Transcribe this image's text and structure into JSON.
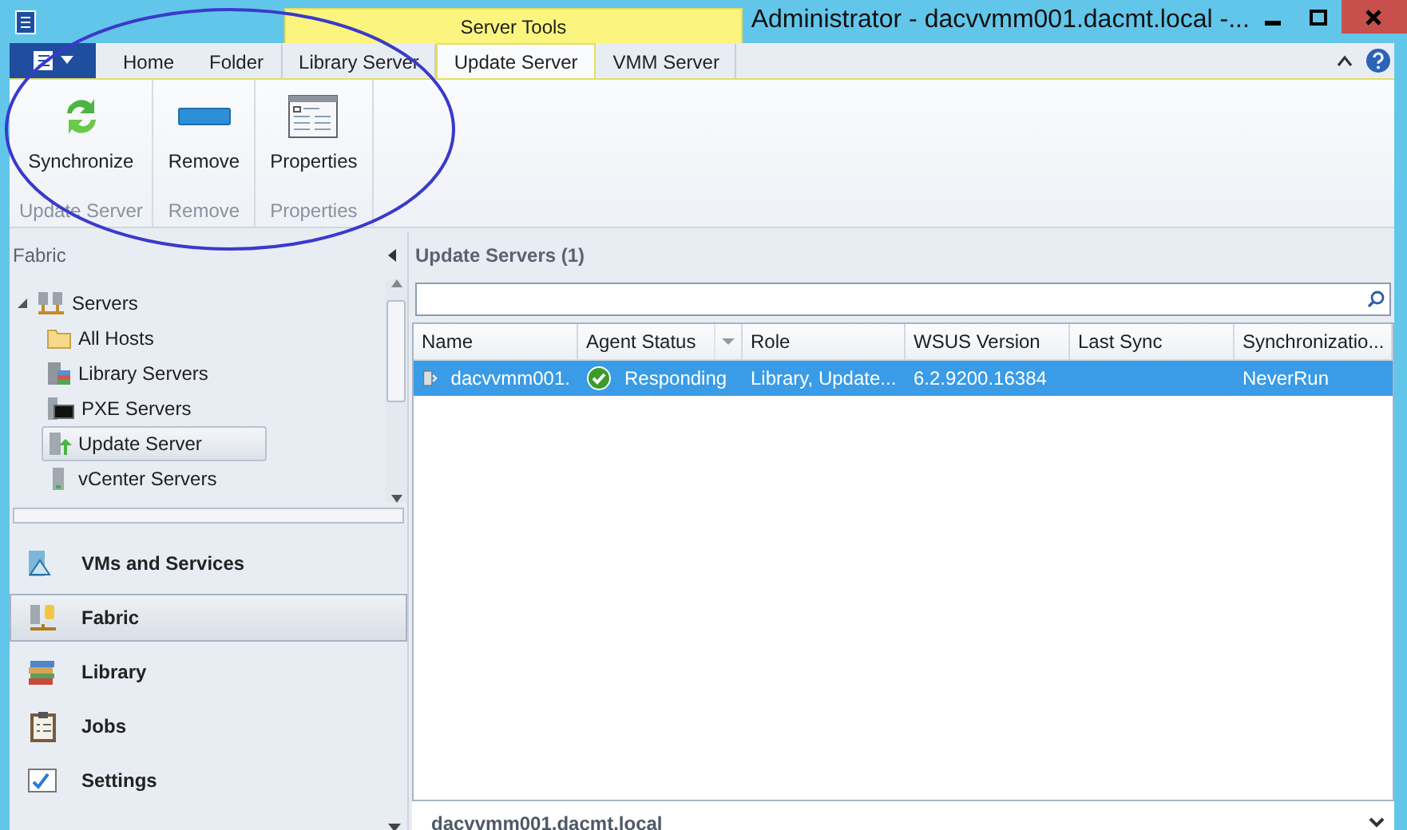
{
  "window": {
    "title": "Administrator - dacvvmm001.dacmt.local -...",
    "contextual_group": "Server Tools"
  },
  "ribbon": {
    "tabs": [
      {
        "label": "Home",
        "selected": false,
        "contextual": false
      },
      {
        "label": "Folder",
        "selected": false,
        "contextual": false
      },
      {
        "label": "Library Server",
        "selected": false,
        "contextual": true
      },
      {
        "label": "Update Server",
        "selected": true,
        "contextual": true
      },
      {
        "label": "VMM Server",
        "selected": false,
        "contextual": true
      }
    ],
    "groups": [
      {
        "label": "Update Server",
        "button": {
          "label": "Synchronize",
          "kind": "sync"
        }
      },
      {
        "label": "Remove",
        "button": {
          "label": "Remove",
          "kind": "remove"
        }
      },
      {
        "label": "Properties",
        "button": {
          "label": "Properties",
          "kind": "properties"
        }
      }
    ]
  },
  "navigation": {
    "title": "Fabric",
    "tree": [
      {
        "label": "Servers",
        "kind": "servers",
        "expanded": true,
        "selected": false,
        "children": [
          {
            "label": "All Hosts",
            "kind": "folder",
            "selected": false
          },
          {
            "label": "Library Servers",
            "kind": "library",
            "selected": false
          },
          {
            "label": "PXE Servers",
            "kind": "pxe",
            "selected": false
          },
          {
            "label": "Update Server",
            "kind": "update",
            "selected": true
          },
          {
            "label": "vCenter Servers",
            "kind": "server",
            "selected": false
          }
        ]
      }
    ],
    "workspaces": [
      {
        "label": "VMs and Services",
        "kind": "vms",
        "selected": false
      },
      {
        "label": "Fabric",
        "kind": "fabric",
        "selected": true
      },
      {
        "label": "Library",
        "kind": "books",
        "selected": false
      },
      {
        "label": "Jobs",
        "kind": "jobs",
        "selected": false
      },
      {
        "label": "Settings",
        "kind": "settings",
        "selected": false
      }
    ]
  },
  "content": {
    "title": "Update Servers (1)",
    "table": {
      "columns": [
        {
          "label": "Name",
          "sorted": false
        },
        {
          "label": "Agent Status",
          "sorted": true
        },
        {
          "label": "Role",
          "sorted": false
        },
        {
          "label": "WSUS Version",
          "sorted": false
        },
        {
          "label": "Last Sync",
          "sorted": false
        },
        {
          "label": "Synchronizatio...",
          "sorted": false
        }
      ],
      "rows": [
        {
          "selected": true,
          "cells": [
            "dacvvmm001.",
            "Responding",
            "Library, Update...",
            "6.2.9200.16384",
            "",
            "NeverRun"
          ]
        }
      ]
    }
  },
  "details": {
    "text": "dacvvmm001.dacmt.local"
  }
}
